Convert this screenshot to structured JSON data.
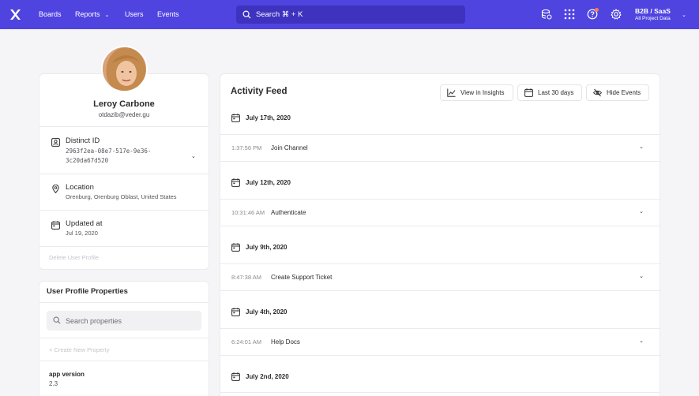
{
  "nav": {
    "links": [
      "Boards",
      "Reports",
      "Users",
      "Events"
    ],
    "search_placeholder": "Search  ⌘ + K",
    "project_name": "B2B / SaaS",
    "project_scope": "All Project Data",
    "accent_color": "#4f44e0"
  },
  "profile": {
    "name": "Leroy Carbone",
    "email": "otdazib@veder.gu",
    "distinct_id_label": "Distinct ID",
    "distinct_id_value": "2963f2ea-08e7-517e-9e36-3c20da67d520",
    "location_label": "Location",
    "location_value": "Orenburg, Orenburg Oblast, United States",
    "updated_label": "Updated at",
    "updated_value": "Jul 19, 2020",
    "delete_label": "Delete User Profile"
  },
  "properties": {
    "title": "User Profile Properties",
    "search_placeholder": "Search properties",
    "create_label": "+ Create New Property",
    "items": [
      {
        "key": "app version",
        "value": "2.3"
      }
    ]
  },
  "feed": {
    "title": "Activity Feed",
    "buttons": {
      "insights": "View in Insights",
      "range": "Last 30 days",
      "hide": "Hide Events"
    },
    "groups": [
      {
        "date": "July 17th, 2020",
        "time": "1:37:56 PM",
        "event": "Join Channel"
      },
      {
        "date": "July 12th, 2020",
        "time": "10:31:46 AM",
        "event": "Authenticate"
      },
      {
        "date": "July 9th, 2020",
        "time": "8:47:38 AM",
        "event": "Create Support Ticket"
      },
      {
        "date": "July 4th, 2020",
        "time": "6:24:01 AM",
        "event": "Help Docs"
      },
      {
        "date": "July 2nd, 2020",
        "time": "",
        "event": ""
      }
    ]
  }
}
